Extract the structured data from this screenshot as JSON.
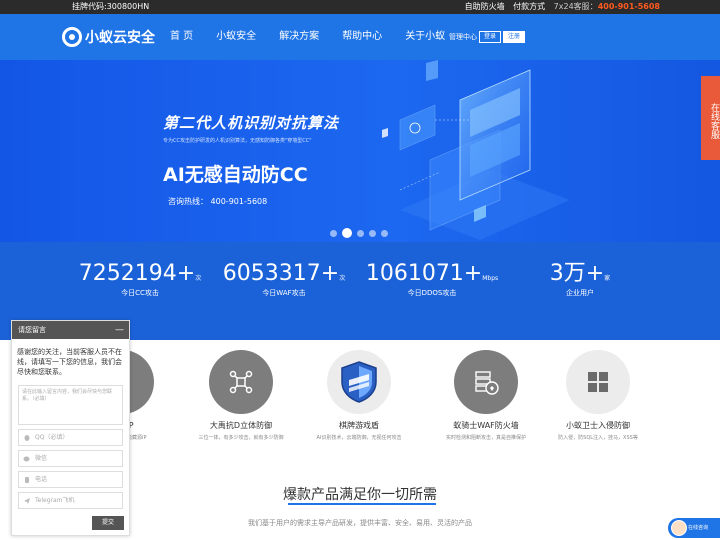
{
  "topbar": {
    "stock_code": "挂牌代码:300800HN",
    "links": [
      "自助防火墙",
      "付款方式"
    ],
    "hotline_label": "7x24客服：",
    "hotline_number": "400-901-5608"
  },
  "header": {
    "logo_text": "小蚁云安全",
    "nav": [
      "首 页",
      "小蚁安全",
      "解决方案",
      "帮助中心",
      "关于小蚁"
    ],
    "management": "管理中心",
    "login": "登录",
    "register": "注册"
  },
  "banner": {
    "title": "第二代人机识别对抗算法",
    "subtitle": "专为CC攻击防护研发的人机识别算法，无感知防御各类\"穿墙型CC\"",
    "headline": "AI无感自动防CC",
    "hotline": "咨询热线：   400-901-5608",
    "slides": 5,
    "active_slide": 1
  },
  "side_service": "在线客服",
  "stats": [
    {
      "number": "7252194+",
      "unit": "次",
      "label": "今日CC攻击"
    },
    {
      "number": "6053317+",
      "unit": "次",
      "label": "今日WAF攻击"
    },
    {
      "number": "1061071+",
      "unit": "Mbps",
      "label": "今日DDOS攻击"
    },
    {
      "number": "3万+",
      "unit": "家",
      "label": "企业用户"
    }
  ],
  "products": [
    {
      "name": "高防IP",
      "desc": "高防IP防护，隐藏源IP",
      "icon": "shield-ip-icon"
    },
    {
      "name": "大禹抗D立体防御",
      "desc": "三位一体，有多少攻击，就有多少防御",
      "icon": "network-node-icon"
    },
    {
      "name": "棋牌游戏盾",
      "desc": "AI识别技术，云端防御，无视任何攻击",
      "icon": "game-shield-icon"
    },
    {
      "name": "蚁骑士WAF防火墙",
      "desc": "实时检测和阻断攻击，真是自推保护",
      "icon": "server-firewall-icon"
    },
    {
      "name": "小蚁卫士入侵防御",
      "desc": "防入侵，防SQL注入，挂马，XSS等",
      "icon": "windows-grid-icon"
    }
  ],
  "section": {
    "title": "爆款产品满足你一切所需",
    "desc": "我们基于用户的需求主导产品研发，提供丰富、安全、易用、灵活的产品"
  },
  "chat": {
    "title": "请您留言",
    "minimize": "—",
    "greeting": "感谢您的关注，当前客服人员不在线，请填写一下您的信息，我们会尽快和您联系。",
    "message_placeholder": "请在此输入留言内容，我们会尽快与您联系。（必填）",
    "fields": [
      "QQ（必填）",
      "微信",
      "电话",
      "Telegram飞机"
    ],
    "submit": "提交"
  },
  "online_chat": "在线咨询",
  "colors": {
    "brand_blue": "#1f74e6",
    "hotline_orange": "#ff5a1f",
    "service_red": "#e85a3a"
  }
}
